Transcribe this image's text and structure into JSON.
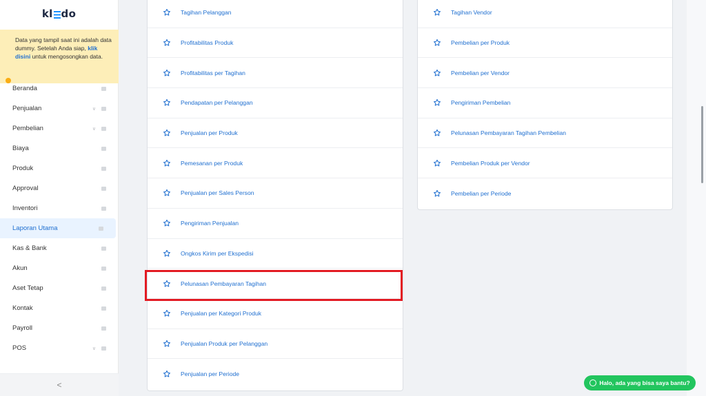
{
  "sidebar": {
    "logo": {
      "left": "kl",
      "right": "do"
    },
    "notice": {
      "text_before": "Data yang tampil saat ini adalah data dummy. Setelah Anda siap, ",
      "link": "klik disini",
      "text_after": " untuk mengosongkan data."
    },
    "items": [
      {
        "label": "Beranda",
        "icon": "home-icon"
      },
      {
        "label": "Penjualan",
        "icon": "basket-icon",
        "expandable": true
      },
      {
        "label": "Pembelian",
        "icon": "bag-icon",
        "expandable": true
      },
      {
        "label": "Biaya",
        "icon": "money-icon"
      },
      {
        "label": "Produk",
        "icon": "box-icon"
      },
      {
        "label": "Approval",
        "icon": "check-icon"
      },
      {
        "label": "Inventori",
        "icon": "inventory-icon"
      },
      {
        "label": "Laporan Utama",
        "icon": "chart-icon",
        "active": true
      },
      {
        "label": "Kas & Bank",
        "icon": "dollar-icon"
      },
      {
        "label": "Akun",
        "icon": "ledger-icon"
      },
      {
        "label": "Aset Tetap",
        "icon": "building-icon"
      },
      {
        "label": "Kontak",
        "icon": "contact-icon"
      },
      {
        "label": "Payroll",
        "icon": "payroll-icon"
      },
      {
        "label": "POS",
        "icon": "pos-icon",
        "expandable": true
      }
    ],
    "collapse_label": "<"
  },
  "reports_left": [
    "Tagihan Pelanggan",
    "Profitabilitas Produk",
    "Profitabilitas per Tagihan",
    "Pendapatan per Pelanggan",
    "Penjualan per Produk",
    "Pemesanan per Produk",
    "Penjualan per Sales Person",
    "Pengiriman Penjualan",
    "Ongkos Kirim per Ekspedisi",
    "Pelunasan Pembayaran Tagihan",
    "Penjualan per Kategori Produk",
    "Penjualan Produk per Pelanggan",
    "Penjualan per Periode"
  ],
  "reports_right": [
    "Tagihan Vendor",
    "Pembelian per Produk",
    "Pembelian per Vendor",
    "Pengiriman Pembelian",
    "Pelunasan Pembayaran Tagihan Pembelian",
    "Pembelian Produk per Vendor",
    "Pembelian per Periode"
  ],
  "chat": {
    "label": "Halo, ada yang bisa saya bantu?"
  },
  "colors": {
    "accent": "#1f6fd0",
    "highlight": "#e31b23",
    "notice_bg": "#fdeeb8",
    "chat": "#22c55e"
  }
}
